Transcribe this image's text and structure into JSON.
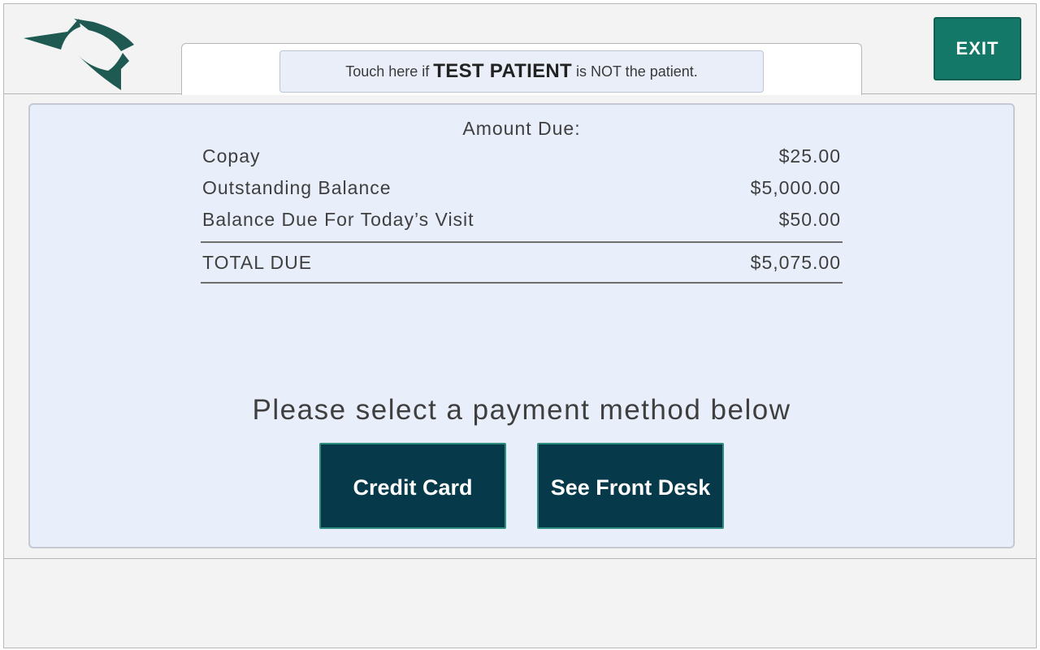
{
  "header": {
    "patient_banner": {
      "prefix": "Touch here if",
      "patient_name": "TEST PATIENT",
      "suffix": "is NOT the patient."
    },
    "exit_label": "EXIT",
    "logo_icon": "clinic-logo",
    "colors": {
      "exit_button": "#137867",
      "logo": "#1f5a52"
    }
  },
  "summary": {
    "title": "Amount Due:",
    "items": [
      {
        "label": "Copay",
        "amount": "$25.00"
      },
      {
        "label": "Outstanding Balance",
        "amount": "$5,000.00"
      },
      {
        "label": "Balance Due For Today’s Visit",
        "amount": "$50.00"
      }
    ],
    "total": {
      "label": "TOTAL DUE",
      "amount": "$5,075.00"
    }
  },
  "payment": {
    "prompt": "Please select a payment method below",
    "credit_card_label": "Credit Card",
    "front_desk_label": "See Front Desk",
    "colors": {
      "button_bg": "#063a4b",
      "button_border": "#2f8e7e"
    }
  }
}
